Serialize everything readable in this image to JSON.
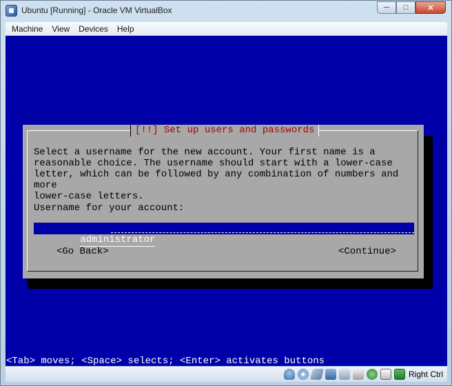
{
  "window": {
    "title": "Ubuntu [Running] - Oracle VM VirtualBox",
    "minimize_glyph": "─",
    "maximize_glyph": "□",
    "close_glyph": "✕"
  },
  "menubar": {
    "items": [
      "Machine",
      "View",
      "Devices",
      "Help"
    ]
  },
  "dialog": {
    "title": "[!!] Set up users and passwords",
    "body": "Select a username for the new account. Your first name is a\nreasonable choice. The username should start with a lower-case\nletter, which can be followed by any combination of numbers and more\nlower-case letters.",
    "field_label": "Username for your account:",
    "username_value": "administrator",
    "go_back": "<Go Back>",
    "continue": "<Continue>"
  },
  "hint": "<Tab> moves; <Space> selects; <Enter> activates buttons",
  "statusbar": {
    "host_key_label": "Right Ctrl",
    "icons": [
      "hard-disk-icon",
      "optical-drive-icon",
      "usb-icon",
      "network-icon",
      "shared-folders-icon",
      "display-icon",
      "virtualization-icon",
      "mouse-integration-icon",
      "keyboard-capture-icon"
    ]
  },
  "colors": {
    "vm_background": "#0000a8",
    "dialog_background": "#a8a8a8",
    "dialog_title": "#a80000"
  }
}
